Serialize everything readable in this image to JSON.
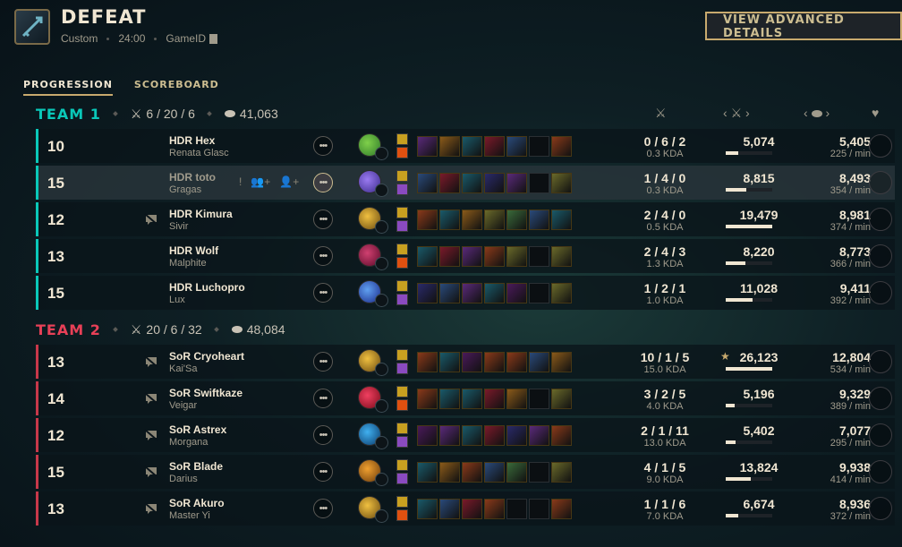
{
  "header": {
    "result": "DEFEAT",
    "mode": "Custom",
    "duration": "24:00",
    "game_id_label": "GameID",
    "advanced_button": "VIEW ADVANCED DETAILS"
  },
  "tabs": [
    {
      "label": "PROGRESSION",
      "active": true
    },
    {
      "label": "SCOREBOARD",
      "active": false
    }
  ],
  "teams": [
    {
      "name": "TEAM 1",
      "color": "#0ac8b9",
      "kda": "6 / 20 / 6",
      "gold": "41,063",
      "players": [
        {
          "level": "10",
          "name": "HDR Hex",
          "champion": "Renata Glasc",
          "kda": "0 / 6 / 2",
          "kda_ratio": "0.3 KDA",
          "damage": "5,074",
          "damage_frac": 0.26,
          "gold": "5,405",
          "gpm": "225 / min"
        },
        {
          "level": "15",
          "name": "HDR toto",
          "champion": "Gragas",
          "kda": "1 / 4 / 0",
          "kda_ratio": "0.3 KDA",
          "damage": "8,815",
          "damage_frac": 0.45,
          "gold": "8,493",
          "gpm": "354 / min"
        },
        {
          "level": "12",
          "name": "HDR Kimura",
          "champion": "Sivir",
          "kda": "2 / 4 / 0",
          "kda_ratio": "0.5 KDA",
          "damage": "19,479",
          "damage_frac": 1.0,
          "gold": "8,981",
          "gpm": "374 / min"
        },
        {
          "level": "13",
          "name": "HDR Wolf",
          "champion": "Malphite",
          "kda": "2 / 4 / 3",
          "kda_ratio": "1.3 KDA",
          "damage": "8,220",
          "damage_frac": 0.42,
          "gold": "8,773",
          "gpm": "366 / min"
        },
        {
          "level": "15",
          "name": "HDR Luchopro",
          "champion": "Lux",
          "kda": "1 / 2 / 1",
          "kda_ratio": "1.0 KDA",
          "damage": "11,028",
          "damage_frac": 0.57,
          "gold": "9,411",
          "gpm": "392 / min"
        }
      ]
    },
    {
      "name": "TEAM 2",
      "color": "#e84057",
      "kda": "20 / 6 / 32",
      "gold": "48,084",
      "players": [
        {
          "level": "13",
          "name": "SoR Cryoheart",
          "champion": "Kai'Sa",
          "kda": "10 / 1 / 5",
          "kda_ratio": "15.0 KDA",
          "damage": "26,123",
          "damage_frac": 1.0,
          "gold": "12,804",
          "gpm": "534 / min"
        },
        {
          "level": "14",
          "name": "SoR Swiftkaze",
          "champion": "Veigar",
          "kda": "3 / 2 / 5",
          "kda_ratio": "4.0 KDA",
          "damage": "5,196",
          "damage_frac": 0.2,
          "gold": "9,329",
          "gpm": "389 / min"
        },
        {
          "level": "12",
          "name": "SoR Astrex",
          "champion": "Morgana",
          "kda": "2 / 1 / 11",
          "kda_ratio": "13.0 KDA",
          "damage": "5,402",
          "damage_frac": 0.21,
          "gold": "7,077",
          "gpm": "295 / min"
        },
        {
          "level": "15",
          "name": "SoR Blade",
          "champion": "Darius",
          "kda": "4 / 1 / 5",
          "kda_ratio": "9.0 KDA",
          "damage": "13,824",
          "damage_frac": 0.53,
          "gold": "9,938",
          "gpm": "414 / min"
        },
        {
          "level": "13",
          "name": "SoR Akuro",
          "champion": "Master Yi",
          "kda": "1 / 1 / 6",
          "kda_ratio": "7.0 KDA",
          "damage": "6,674",
          "damage_frac": 0.26,
          "gold": "8,936",
          "gpm": "372 / min"
        }
      ]
    }
  ],
  "columns": {
    "kda_icon": "crossed-swords-icon",
    "damage_icon": "sword-icon",
    "gold_icon": "coins-icon",
    "ward_icon": "ward-icon"
  },
  "colors": {
    "accent_gold": "#c8aa6e",
    "team1": "#0ac8b9",
    "team2": "#e84057"
  }
}
